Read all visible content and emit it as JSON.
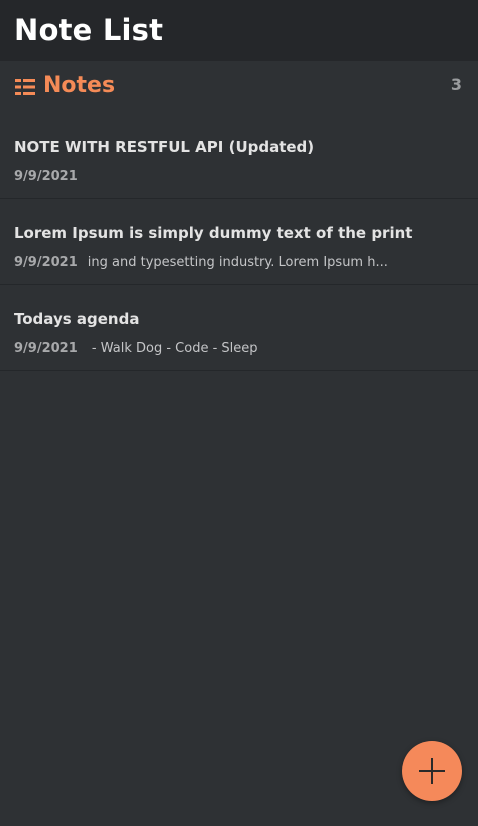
{
  "app": {
    "title": "Note List"
  },
  "colors": {
    "accent": "#f58b57",
    "background": "#2e3134",
    "header_background": "#25272a"
  },
  "section": {
    "icon": "list-icon",
    "title": "Notes",
    "count": "3"
  },
  "notes": [
    {
      "title": "NOTE WITH RESTFUL API (Updated)",
      "date": "9/9/2021",
      "snippet": ""
    },
    {
      "title": "Lorem Ipsum is simply dummy text of the print",
      "date": "9/9/2021",
      "snippet": "ing and typesetting industry. Lorem Ipsum h..."
    },
    {
      "title": "Todays agenda",
      "date": "9/9/2021",
      "snippet": " - Walk Dog - Code - Sleep"
    }
  ],
  "fab": {
    "icon": "plus-icon"
  }
}
